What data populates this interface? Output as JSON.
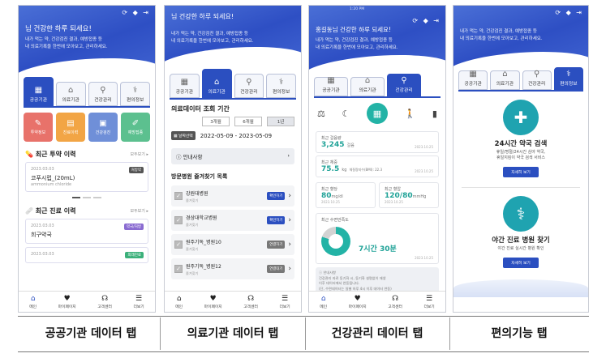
{
  "p1": {
    "greeting": "님 건강한 하루 되세요!",
    "sub1": "내가 먹는 약, 건강검진 결과, 예방접종 등",
    "sub2": "내 의료기록을 한번에 모아보고, 관리하세요.",
    "tabs": [
      "공공기관",
      "의료기관",
      "건강관리",
      "편의정보"
    ],
    "cards": [
      {
        "label": "투약정보",
        "color": "#e8726a"
      },
      {
        "label": "진료이력",
        "color": "#f2a545"
      },
      {
        "label": "건강검진",
        "color": "#6f8fd8"
      },
      {
        "label": "예방접종",
        "color": "#5cc08f"
      }
    ],
    "sec1": "최근 투약 이력",
    "sec2": "최근 진료 이력",
    "more": "모두보기",
    "drug": {
      "date": "2023.03.03",
      "name": "코푸시럽_(20mL)",
      "en": "ammonium chloride",
      "tag": "처방약"
    },
    "visit": {
      "date": "2023.03.03",
      "name": "희구약국",
      "tag": "약국/처방"
    },
    "visit2": {
      "date": "2023.03.03",
      "tag": "외래진료"
    }
  },
  "p2": {
    "greeting": "님 건강한 하루 되세요!",
    "sub1": "내가 먹는 약, 건강검진 결과, 예방접종 등",
    "sub2": "내 의료기록을 한번에 모아보고, 관리하세요.",
    "tabs": [
      "공공기관",
      "의료기관",
      "건강관리",
      "편의정보"
    ],
    "period_title": "의료데이터 조회 기간",
    "periods": [
      "3개월",
      "6개월",
      "1년"
    ],
    "date_btn": "날짜선택",
    "date_range": "2022-05-09 - 2023-05-09",
    "notice": "안내사항",
    "list_title": "방문병원 즐겨찾기 목록",
    "hospitals": [
      {
        "name": "강원대병원",
        "sub": "즐겨찾기",
        "btn": "확인하기"
      },
      {
        "name": "경상대학교병원",
        "sub": "즐겨찾기",
        "btn": "확인하기"
      },
      {
        "name": "원주기독_병원10",
        "sub": "즐겨찾기",
        "btn": "연결하기"
      },
      {
        "name": "원주기독_병원12",
        "sub": "즐겨찾기",
        "btn": "연결대기"
      }
    ]
  },
  "p3": {
    "greeting": "홍길동님 건강한 하루 되세요!",
    "sub1": "내가 먹는 약, 건강검진 결과, 예방접종 등",
    "sub2": "내 의료기록을 한번에 모아보고, 관리하세요.",
    "time": "1:20 PM",
    "tabs": [
      "공공기관",
      "의료기관",
      "건강관리"
    ],
    "steps": {
      "label": "최근 걸음량",
      "value": "3,245",
      "unit": "걸음",
      "date": "2023.10.25"
    },
    "weight": {
      "label": "최근 체중",
      "value": "75.5",
      "unit": "kg",
      "extra": "체질량지수(BMI): 22.3",
      "date": "2023.10.25"
    },
    "sugar": {
      "label": "최근 혈당",
      "value": "80",
      "unit": "mg/dl",
      "date": "2023.10.25"
    },
    "bp": {
      "label": "최근 혈압",
      "value": "120/80",
      "unit": "mmHg",
      "date": "2023.10.25"
    },
    "sleep": {
      "label": "최근 수면만족도",
      "value": "7시간 30분",
      "date": "2023.10.25"
    },
    "note": [
      "안내사항",
      "건강관리 자료 동기화 시, 동기화 설명없이 재생",
      "이후 데이터에서 연동됩니다.",
      "(단, 수면데이터는 일별 하루 4시 이후 데이터 연동)"
    ]
  },
  "p4": {
    "tabs": [
      "공공기관",
      "의료기관",
      "건강관리",
      "편의정보"
    ],
    "sub1": "내가 먹는 약, 건강검진 결과, 예방접종 등",
    "sub2": "내 의료기록을 한번에 모아보고, 관리하세요.",
    "f1": {
      "title": "24시간 약국 검색",
      "d1": "휴일/명절/24시간 심야 약국,",
      "d2": "휴일지킴이 약국 검색 서비스",
      "btn": "자세히 보기"
    },
    "f2": {
      "title": "야간 진료 병원 찾기",
      "d1": "야간 진료 실시간 병원 확인",
      "btn": "자세히 보기"
    }
  },
  "nav": [
    "메인",
    "마이페이지",
    "고객센터",
    "더보기"
  ],
  "captions": [
    "공공기관 데이터 탭",
    "의료기관 데이터 탭",
    "건강관리 데이터 탭",
    "편의기능 탭"
  ]
}
